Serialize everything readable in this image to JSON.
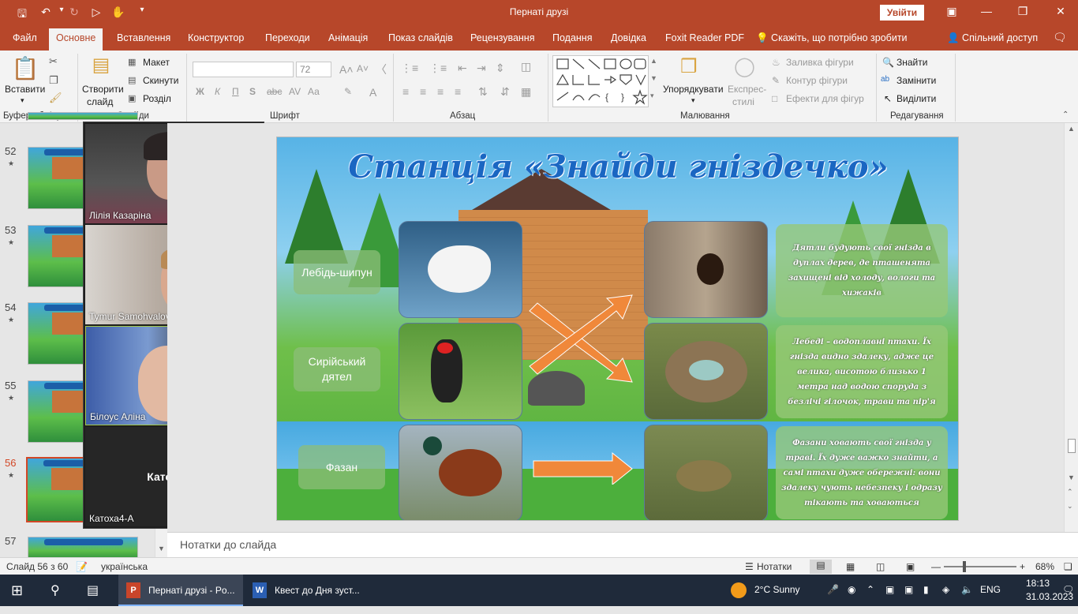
{
  "window": {
    "title": "Пернаті друзі",
    "signin": "Увійти"
  },
  "tabs": [
    "Файл",
    "Основне",
    "Вставлення",
    "Конструктор",
    "Переходи",
    "Анімація",
    "Показ слайдів",
    "Рецензування",
    "Подання",
    "Довідка",
    "Foxit Reader PDF",
    "Скажіть, що потрібно зробити",
    "Спільний доступ"
  ],
  "ribbon": {
    "clipboard": {
      "paste": "Вставити",
      "label": "Буфер обміну"
    },
    "slides": {
      "new": "Створити",
      "new2": "слайд",
      "layout": "Макет",
      "reset": "Скинути",
      "section": "Розділ",
      "label": "Слайди"
    },
    "font": {
      "name": "",
      "size": "72",
      "bold": "Ж",
      "italic": "К",
      "underline": "П",
      "strike": "S",
      "spacing": "Аа",
      "label": "Шрифт"
    },
    "paragraph": {
      "label": "Абзац"
    },
    "drawing": {
      "arrange": "Упорядкувати",
      "styles1": "Експрес-",
      "styles2": "стилі",
      "fill": "Заливка фігури",
      "outline": "Контур фігури",
      "effects": "Ефекти для фігур",
      "label": "Малювання"
    },
    "editing": {
      "find": "Знайти",
      "replace": "Замінити",
      "select": "Виділити",
      "label": "Редагування"
    }
  },
  "thumbnails": [
    {
      "num": "52"
    },
    {
      "num": "53"
    },
    {
      "num": "54"
    },
    {
      "num": "55"
    },
    {
      "num": "56"
    },
    {
      "num": "57"
    }
  ],
  "video": {
    "participants": [
      {
        "name": "Лілія Казаріна"
      },
      {
        "name": "Tymur Samohvalov 4-A"
      },
      {
        "name": "Білоус Аліна"
      },
      {
        "name": "Катоха4-А",
        "center": "Катоха4-А"
      }
    ]
  },
  "slide": {
    "title": "Станція «Знайди гніздечко»",
    "birds": [
      "Лебідь-шипун",
      "Сирійський дятел",
      "Фазан"
    ],
    "descriptions": [
      "Дятли будують свої гнізда в дуплах дерев, де пташенята захищені від холоду, вологи та хижаків",
      "Лебеді – водоплавні птахи. Їх гнізда видно здалеку, адже це велика, висотою близько 1 метра над водою споруда з безлічі гілочок, трави та пір'я",
      "Фазани ховають свої гнізда у траві. Їх дуже важко знайти, а самі птахи дуже обережні: вони здалеку чують небезпеку і одразу тікають та ховаються"
    ]
  },
  "notes": {
    "placeholder": "Нотатки до слайда"
  },
  "status": {
    "slide": "Слайд 56 з 60",
    "language": "українська",
    "notes": "Нотатки",
    "zoom": "68%"
  },
  "taskbar": {
    "apps": [
      "Пернаті друзі - Po...",
      "Квест  до Дня зуст..."
    ],
    "weather": "2°C  Sunny",
    "lang": "ENG",
    "time": "18:13",
    "date": "31.03.2023"
  },
  "colors": {
    "accent": "#b7472a",
    "slideTitle": "#1a66c2",
    "arrow": "#f0883a"
  }
}
